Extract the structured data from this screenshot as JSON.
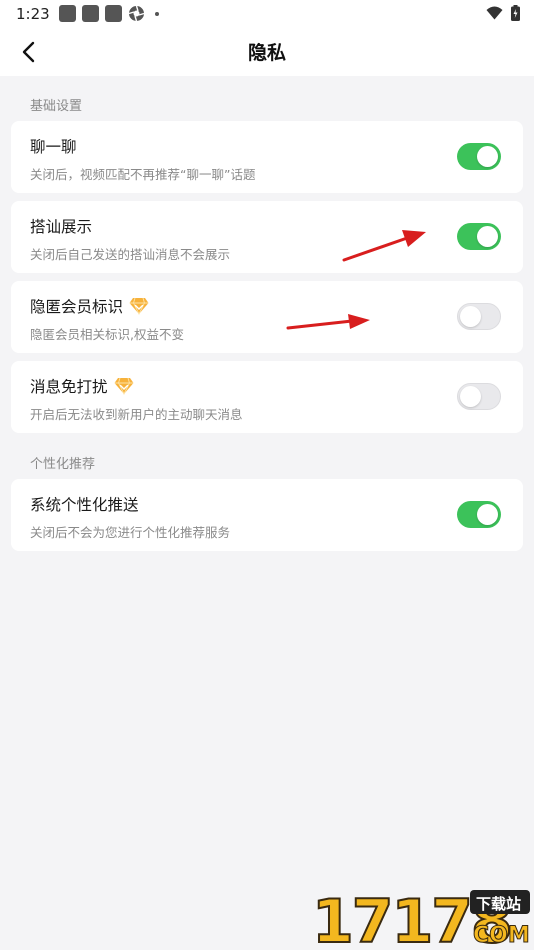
{
  "status_bar": {
    "time": "1:23"
  },
  "header": {
    "title": "隐私"
  },
  "sections": [
    {
      "title": "基础设置",
      "items": [
        {
          "title": "聊一聊",
          "desc": "关闭后，视频匹配不再推荐“聊一聊”话题",
          "enabled": true,
          "vip": false
        },
        {
          "title": "搭讪展示",
          "desc": "关闭后自己发送的搭讪消息不会展示",
          "enabled": true,
          "vip": false
        },
        {
          "title": "隐匿会员标识",
          "desc": "隐匿会员相关标识,权益不变",
          "enabled": false,
          "vip": true
        },
        {
          "title": "消息免打扰",
          "desc": "开启后无法收到新用户的主动聊天消息",
          "enabled": false,
          "vip": true
        }
      ]
    },
    {
      "title": "个性化推荐",
      "items": [
        {
          "title": "系统个性化推送",
          "desc": "关闭后不会为您进行个性化推荐服务",
          "enabled": true,
          "vip": false
        }
      ]
    }
  ],
  "watermark": {
    "number": "17178",
    "badge": "下载站",
    "domain": "COM"
  },
  "colors": {
    "toggle_on": "#3cc25a",
    "toggle_off": "#e9e9ec",
    "annotation_arrow": "#d81e1e",
    "gem": "#f5a623"
  }
}
